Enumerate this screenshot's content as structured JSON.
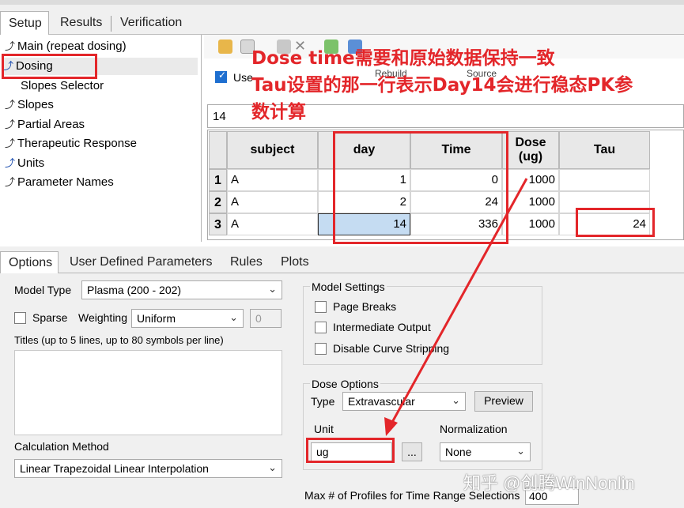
{
  "top_tabs": [
    "Setup",
    "Results",
    "Verification"
  ],
  "tree": {
    "items": [
      "Main (repeat dosing)",
      "Dosing",
      "Slopes Selector",
      "Slopes",
      "Partial Areas",
      "Therapeutic Response",
      "Units",
      "Parameter Names"
    ]
  },
  "toolbar": {
    "use_label": "Use",
    "rebuild_label": "Rebuild",
    "source_label": "Source"
  },
  "formula_value": "14",
  "table": {
    "columns": [
      "subject",
      "day",
      "Time",
      "Dose\n(ug)",
      "Tau"
    ],
    "rows": [
      {
        "num": "1",
        "subject": "A",
        "day": "1",
        "time": "0",
        "dose": "1000",
        "tau": ""
      },
      {
        "num": "2",
        "subject": "A",
        "day": "2",
        "time": "24",
        "dose": "1000",
        "tau": ""
      },
      {
        "num": "3",
        "subject": "A",
        "day": "14",
        "time": "336",
        "dose": "1000",
        "tau": "24"
      }
    ]
  },
  "annotations": {
    "line1": "Dose time需要和原始数据保持一致",
    "line2": "Tau设置的那一行表示Day14会进行稳态PK参",
    "line3": "数计算"
  },
  "bottom_tabs": [
    "Options",
    "User Defined Parameters",
    "Rules",
    "Plots"
  ],
  "options": {
    "model_type_label": "Model Type",
    "model_type_value": "Plasma (200 - 202)",
    "sparse_label": "Sparse",
    "weighting_label": "Weighting",
    "weighting_value": "Uniform",
    "weighting_number": "0",
    "titles_label": "Titles (up to 5 lines, up to 80 symbols per line)",
    "calc_method_label": "Calculation Method",
    "calc_method_value": "Linear Trapezoidal Linear Interpolation",
    "model_settings_label": "Model Settings",
    "page_breaks_label": "Page Breaks",
    "intermediate_output_label": "Intermediate Output",
    "disable_curve_label": "Disable Curve Stripping",
    "dose_options_label": "Dose Options",
    "type_label": "Type",
    "type_value": "Extravascular",
    "preview_label": "Preview",
    "unit_label": "Unit",
    "unit_value": "ug",
    "ellipsis_label": "...",
    "normalization_label": "Normalization",
    "normalization_value": "None",
    "max_profiles_label": "Max # of Profiles for Time Range Selections",
    "max_profiles_value": "400"
  },
  "watermark": "知乎 @创腾WinNonlin",
  "colors": {
    "annotation_red": "#e3262a",
    "selected_cell": "#c5dcf2"
  }
}
